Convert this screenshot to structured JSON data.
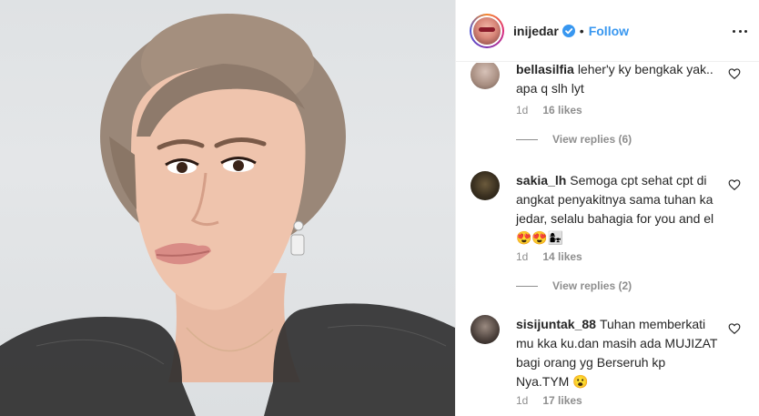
{
  "post": {
    "username": "inijedar",
    "follow_label": "Follow",
    "separator": "•",
    "icons": {
      "verified": "verified-badge-icon",
      "more": "more-options-icon",
      "like": "heart-icon"
    },
    "colors": {
      "follow": "#3897f0",
      "verified": "#3897f0",
      "muted": "#8e8e8e"
    }
  },
  "comments": [
    {
      "user": "bellasilfia",
      "text": "leher'y ky bengkak yak.. apa q slh lyt",
      "time": "1d",
      "likes": "16 likes",
      "view_replies": "View replies (6)"
    },
    {
      "user": "sakia_lh",
      "text": "Semoga cpt sehat cpt di angkat penyakitnya sama tuhan ka jedar, selalu bahagia for you and el 😍😍👩‍👧",
      "time": "1d",
      "likes": "14 likes",
      "view_replies": "View replies (2)"
    },
    {
      "user": "sisijuntak_88",
      "text": "Tuhan memberkati mu kka ku.dan masih ada MUJIZAT bagi orang yg Berseruh kp Nya.TYM 😮",
      "time": "1d",
      "likes": "17 likes",
      "view_replies": ""
    }
  ]
}
